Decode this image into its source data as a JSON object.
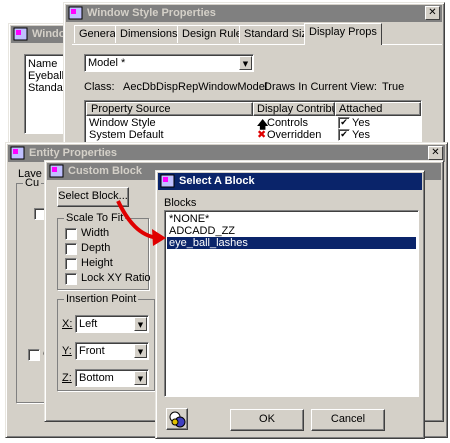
{
  "window_style": {
    "back_title": "Windo",
    "title": "Window Style Properties",
    "tabs": [
      "General",
      "Dimensions",
      "Design Rules",
      "Standard Sizes",
      "Display Props"
    ],
    "left_list_header": "Name",
    "left_list_items": [
      "Eyeball",
      "Standard"
    ],
    "model_combo": "Model *",
    "class_label": "Class:",
    "class_value": "AecDbDispRepWindowModel",
    "draws_label": "Draws In Current View:",
    "draws_value": "True",
    "table_headers": [
      "Property Source",
      "Display Contribut...",
      "Attached"
    ],
    "rows": [
      {
        "source": "Window Style",
        "contribution": "Controls",
        "attached": "Yes"
      },
      {
        "source": "System Default",
        "contribution": "Overridden",
        "attached": "Yes"
      }
    ]
  },
  "entity_properties": {
    "title": "Entity Properties",
    "tab_partial": "Laye",
    "group_partial": "Cu"
  },
  "custom_block": {
    "title": "Custom Block",
    "select_block_button": "Select Block...",
    "scale_group": "Scale To Fit",
    "checkboxes": [
      "Width",
      "Depth",
      "Height",
      "Lock XY Ratio"
    ],
    "insertion_group": "Insertion Point",
    "x_label": "X:",
    "x_value": "Left",
    "y_label": "Y:",
    "y_value": "Front",
    "z_label": "Z:",
    "z_value": "Bottom"
  },
  "select_block": {
    "title": "Select A Block",
    "blocks_label": "Blocks",
    "blocks": [
      "*NONE*",
      "ADCADD_ZZ",
      "eye_ball_lashes"
    ],
    "selected_index": 2,
    "ok_button": "OK",
    "cancel_button": "Cancel"
  },
  "colors": {
    "title_active": "#0a246a",
    "title_inactive": "#808080",
    "face": "#d4d0c8",
    "arrow": "#e00000"
  }
}
